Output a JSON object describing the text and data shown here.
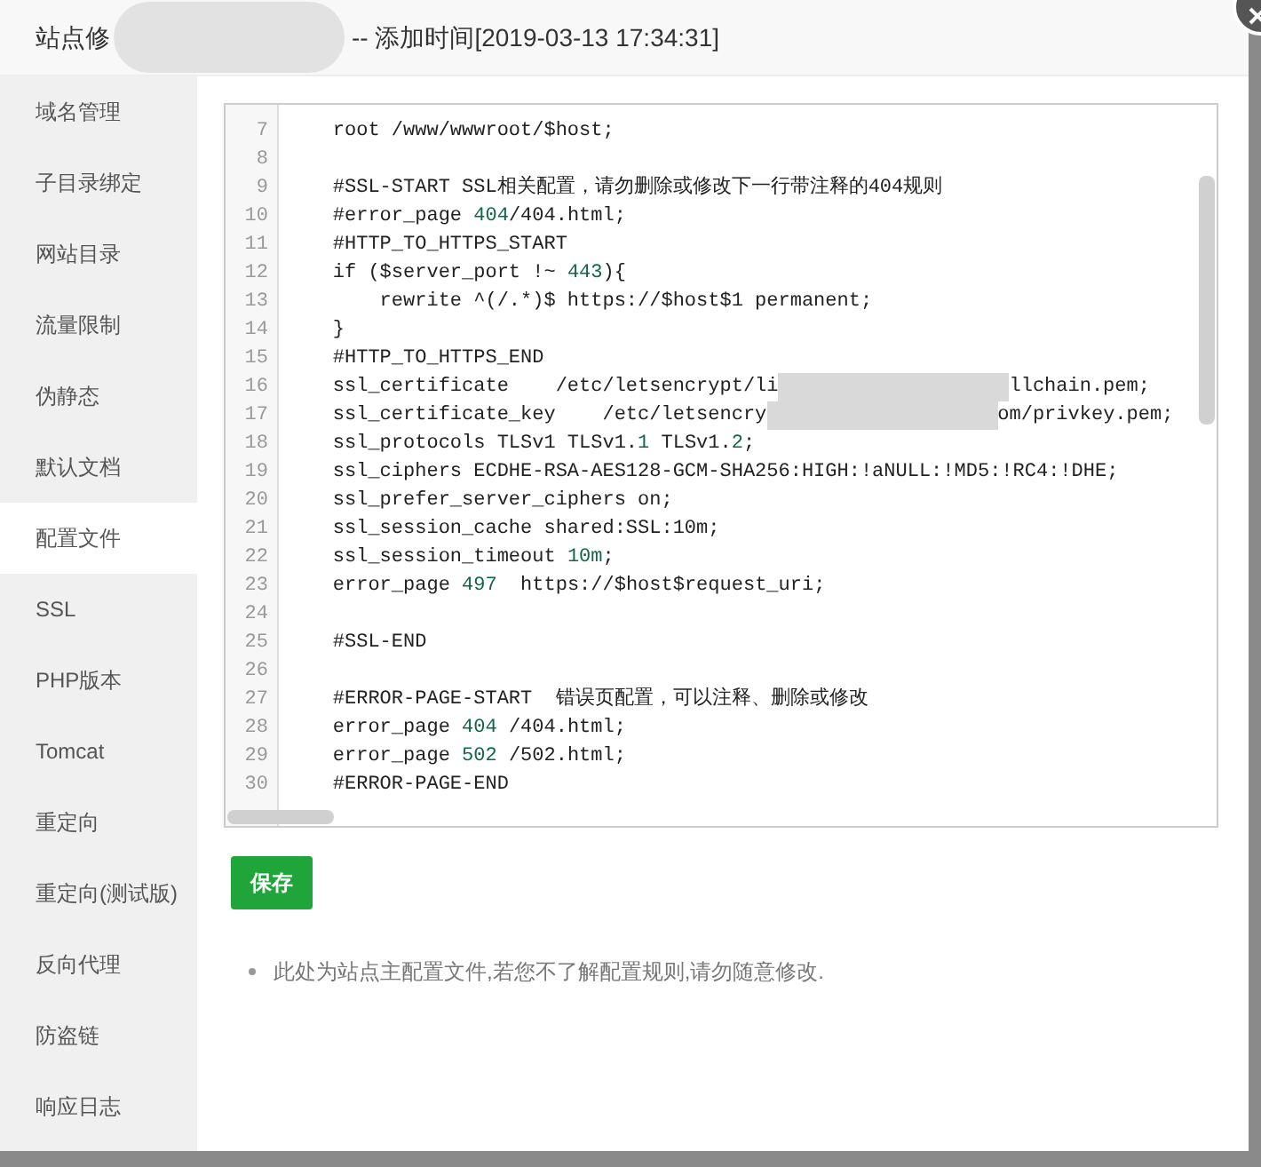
{
  "dialog": {
    "title_prefix": "站点修",
    "title_suffix": "-- 添加时间[2019-03-13 17:34:31]"
  },
  "sidebar": {
    "items": [
      {
        "label": "域名管理",
        "selected": false
      },
      {
        "label": "子目录绑定",
        "selected": false
      },
      {
        "label": "网站目录",
        "selected": false
      },
      {
        "label": "流量限制",
        "selected": false
      },
      {
        "label": "伪静态",
        "selected": false
      },
      {
        "label": "默认文档",
        "selected": false
      },
      {
        "label": "配置文件",
        "selected": true
      },
      {
        "label": "SSL",
        "selected": false
      },
      {
        "label": "PHP版本",
        "selected": false
      },
      {
        "label": "Tomcat",
        "selected": false
      },
      {
        "label": "重定向",
        "selected": false
      },
      {
        "label": "重定向(测试版)",
        "selected": false
      },
      {
        "label": "反向代理",
        "selected": false
      },
      {
        "label": "防盗链",
        "selected": false
      },
      {
        "label": "响应日志",
        "selected": false
      }
    ]
  },
  "editor": {
    "lines": [
      {
        "number": "7",
        "parts": [
          {
            "kind": "text",
            "text": "    root /www/wwwroot/$host;"
          }
        ]
      },
      {
        "number": "8"
      },
      {
        "number": "9",
        "parts": [
          {
            "kind": "text",
            "text": "    #SSL-START SSL相关配置，请勿删除或修改下一行带注释的404规则"
          }
        ]
      },
      {
        "number": "10",
        "parts": [
          {
            "kind": "text",
            "text": "    #error_page "
          },
          {
            "kind": "number",
            "text": "404"
          },
          {
            "kind": "text",
            "text": "/404.html;"
          }
        ]
      },
      {
        "number": "11",
        "parts": [
          {
            "kind": "text",
            "text": "    #HTTP_TO_HTTPS_START"
          }
        ]
      },
      {
        "number": "12",
        "parts": [
          {
            "kind": "text",
            "text": "    if ($server_port !~ "
          },
          {
            "kind": "number",
            "text": "443"
          },
          {
            "kind": "text",
            "text": "){"
          }
        ]
      },
      {
        "number": "13",
        "parts": [
          {
            "kind": "text",
            "text": "        rewrite ^(/.*)$ https://$host$1 permanent;"
          }
        ]
      },
      {
        "number": "14",
        "parts": [
          {
            "kind": "text",
            "text": "    }"
          }
        ]
      },
      {
        "number": "15",
        "parts": [
          {
            "kind": "text",
            "text": "    #HTTP_TO_HTTPS_END"
          }
        ]
      },
      {
        "number": "16",
        "parts": [
          {
            "kind": "text",
            "text": "    ssl_certificate    /etc/letsencrypt/li"
          },
          {
            "kind": "blur"
          },
          {
            "kind": "text",
            "text": "llchain.pem;"
          }
        ]
      },
      {
        "number": "17",
        "parts": [
          {
            "kind": "text",
            "text": "    ssl_certificate_key    /etc/letsencry"
          },
          {
            "kind": "blur"
          },
          {
            "kind": "text",
            "text": "om/privkey.pem;"
          }
        ]
      },
      {
        "number": "18",
        "parts": [
          {
            "kind": "text",
            "text": "    ssl_protocols TLSv1 TLSv1."
          },
          {
            "kind": "number",
            "text": "1"
          },
          {
            "kind": "text",
            "text": " TLSv1."
          },
          {
            "kind": "number",
            "text": "2"
          },
          {
            "kind": "text",
            "text": ";"
          }
        ]
      },
      {
        "number": "19",
        "parts": [
          {
            "kind": "text",
            "text": "    ssl_ciphers ECDHE-RSA-AES128-GCM-SHA256:HIGH:!aNULL:!MD5:!RC4:!DHE;"
          }
        ]
      },
      {
        "number": "20",
        "parts": [
          {
            "kind": "text",
            "text": "    ssl_prefer_server_ciphers on;"
          }
        ]
      },
      {
        "number": "21",
        "parts": [
          {
            "kind": "text",
            "text": "    ssl_session_cache shared:SSL:10m;"
          }
        ]
      },
      {
        "number": "22",
        "parts": [
          {
            "kind": "text",
            "text": "    ssl_session_timeout "
          },
          {
            "kind": "number",
            "text": "10m"
          },
          {
            "kind": "text",
            "text": ";"
          }
        ]
      },
      {
        "number": "23",
        "parts": [
          {
            "kind": "text",
            "text": "    error_page "
          },
          {
            "kind": "number",
            "text": "497"
          },
          {
            "kind": "text",
            "text": "  https://$host$request_uri;"
          }
        ]
      },
      {
        "number": "24"
      },
      {
        "number": "25",
        "parts": [
          {
            "kind": "text",
            "text": "    #SSL-END"
          }
        ]
      },
      {
        "number": "26"
      },
      {
        "number": "27",
        "parts": [
          {
            "kind": "text",
            "text": "    #ERROR-PAGE-START  错误页配置，可以注释、删除或修改"
          }
        ]
      },
      {
        "number": "28",
        "parts": [
          {
            "kind": "text",
            "text": "    error_page "
          },
          {
            "kind": "number",
            "text": "404"
          },
          {
            "kind": "text",
            "text": " /404.html;"
          }
        ]
      },
      {
        "number": "29",
        "parts": [
          {
            "kind": "text",
            "text": "    error_page "
          },
          {
            "kind": "number",
            "text": "502"
          },
          {
            "kind": "text",
            "text": " /502.html;"
          }
        ]
      },
      {
        "number": "30",
        "parts": [
          {
            "kind": "text",
            "text": "    #ERROR-PAGE-END"
          }
        ]
      }
    ]
  },
  "save_button": "保存",
  "notes": [
    "此处为站点主配置文件,若您不了解配置规则,请勿随意修改."
  ]
}
